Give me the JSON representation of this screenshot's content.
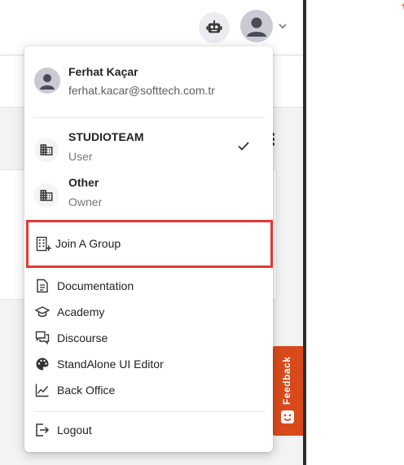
{
  "header": {
    "assistant_icon": "robot-icon",
    "profile_icon": "person-icon",
    "more_icon": "more-vertical-icon"
  },
  "user": {
    "name": "Ferhat Kaçar",
    "email": "ferhat.kacar@softtech.com.tr"
  },
  "organizations": [
    {
      "name": "STUDIOTEAM",
      "role": "User",
      "selected": true,
      "icon": "building-icon"
    },
    {
      "name": "Other",
      "role": "Owner",
      "selected": false,
      "icon": "building-icon"
    }
  ],
  "join_group": {
    "label": "Join A Group",
    "icon": "add-building-icon"
  },
  "links": [
    {
      "label": "Documentation",
      "icon": "document-icon"
    },
    {
      "label": "Academy",
      "icon": "graduation-cap-icon"
    },
    {
      "label": "Discourse",
      "icon": "forum-icon"
    },
    {
      "label": "StandAlone UI Editor",
      "icon": "palette-icon"
    },
    {
      "label": "Back Office",
      "icon": "line-chart-icon"
    }
  ],
  "logout": {
    "label": "Logout",
    "icon": "logout-icon"
  },
  "feedback": {
    "label": "Feedback",
    "icon": "smile-icon"
  },
  "colors": {
    "highlight_border": "#e53935",
    "feedback_bg": "#d84a1b",
    "avatar_bg": "#c9cad3"
  }
}
